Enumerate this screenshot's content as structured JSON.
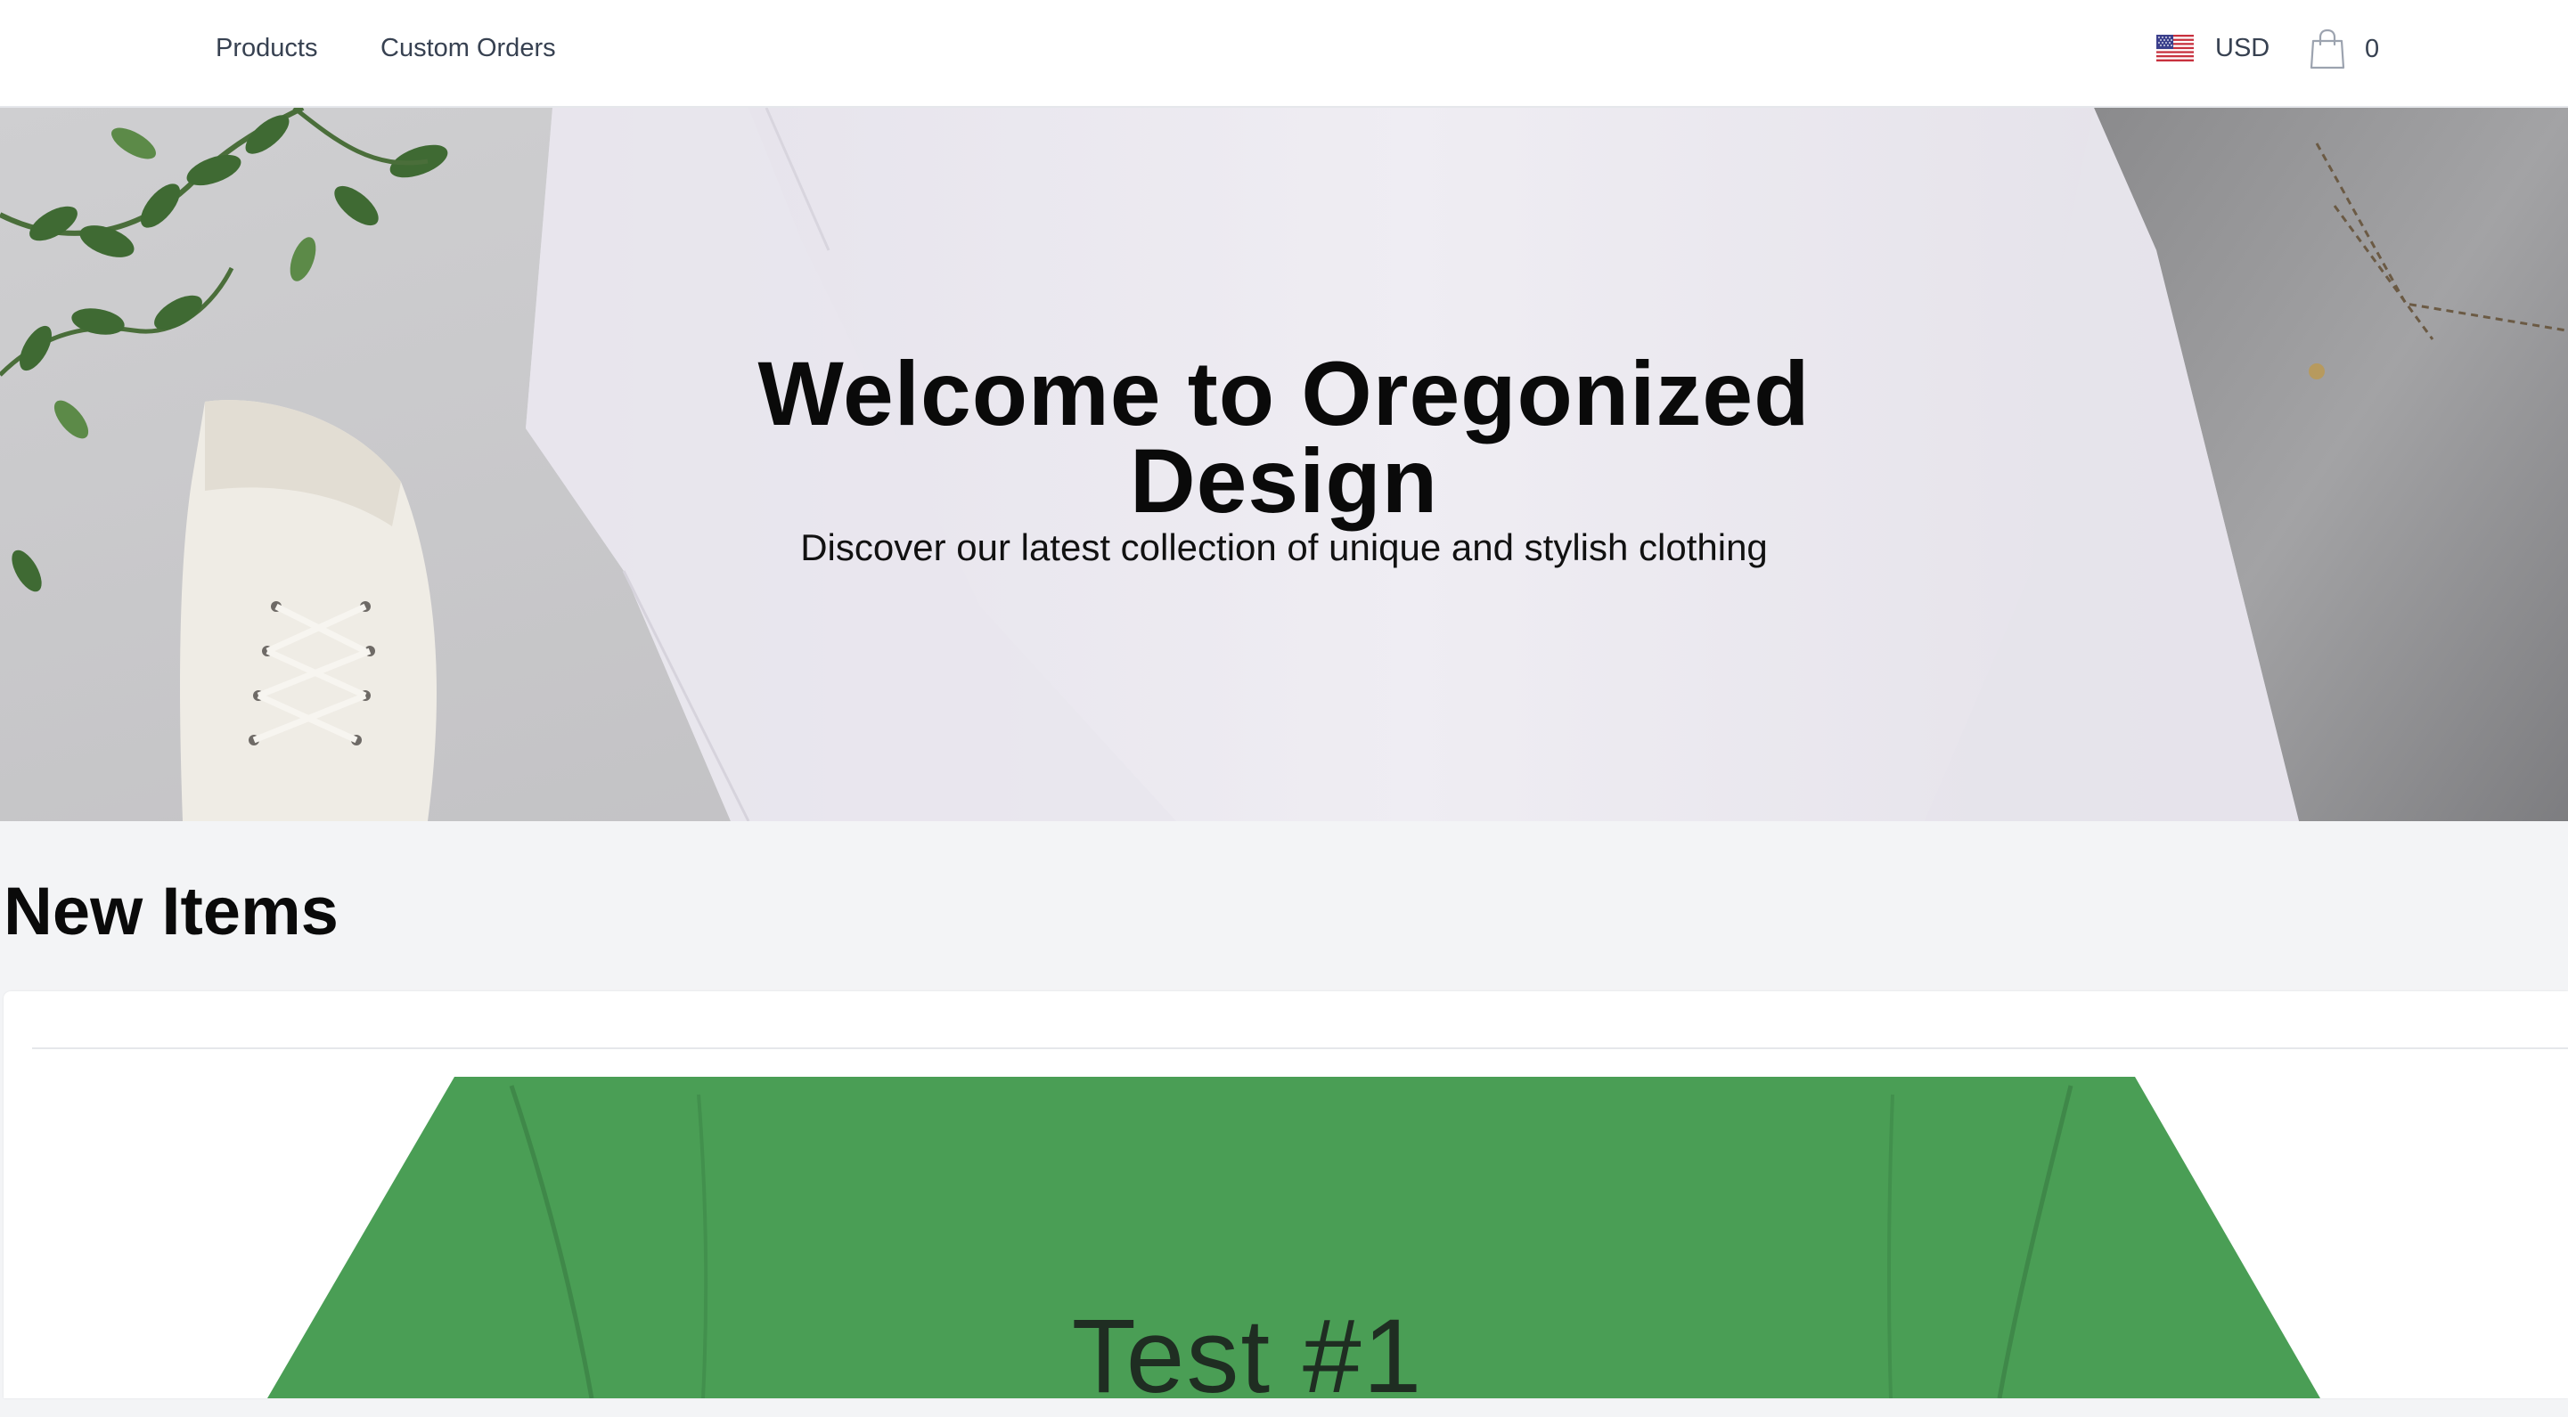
{
  "nav": {
    "products_label": "Products",
    "custom_orders_label": "Custom Orders"
  },
  "currency": {
    "label": "USD",
    "flag_icon": "us-flag-icon"
  },
  "cart": {
    "icon": "shopping-bag-icon",
    "count": "0"
  },
  "hero": {
    "title": "Welcome to Oregonized Design",
    "subtitle": "Discover our latest collection of unique and stylish clothing"
  },
  "new_items": {
    "heading": "New Items",
    "products": [
      {
        "print_text": "Test #1",
        "color": "#4a9e55"
      }
    ]
  },
  "colors": {
    "header_bg": "#ffffff",
    "page_bg": "#f3f4f6",
    "nav_text": "#374151",
    "product_green": "#4a9e55"
  }
}
